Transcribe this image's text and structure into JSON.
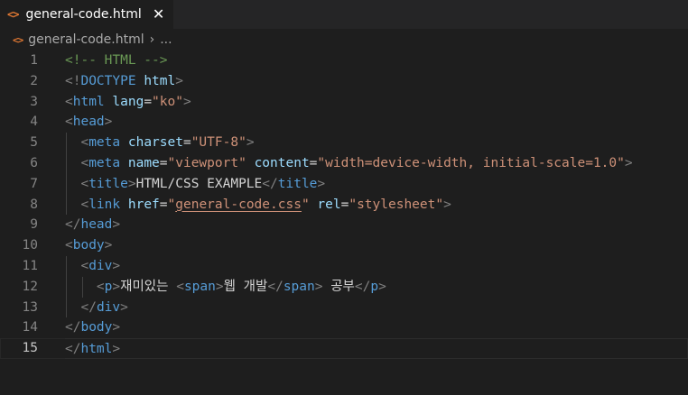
{
  "tab": {
    "icon": "<>",
    "filename": "general-code.html",
    "close": "✕"
  },
  "breadcrumb": {
    "icon": "<>",
    "file": "general-code.html",
    "separator": "›",
    "more": "..."
  },
  "editor": {
    "current_line": 15,
    "lines": [
      {
        "n": "1",
        "tokens": [
          [
            "t-comment",
            "<!-- HTML -->"
          ]
        ]
      },
      {
        "n": "2",
        "tokens": [
          [
            "t-punct",
            "<!"
          ],
          [
            "t-tag",
            "DOCTYPE"
          ],
          [
            "t-text",
            " "
          ],
          [
            "t-attr",
            "html"
          ],
          [
            "t-punct",
            ">"
          ]
        ]
      },
      {
        "n": "3",
        "tokens": [
          [
            "t-punct",
            "<"
          ],
          [
            "t-tag",
            "html"
          ],
          [
            "t-text",
            " "
          ],
          [
            "t-attr",
            "lang"
          ],
          [
            "t-text",
            "="
          ],
          [
            "t-str",
            "\"ko\""
          ],
          [
            "t-punct",
            ">"
          ]
        ]
      },
      {
        "n": "4",
        "tokens": [
          [
            "t-punct",
            "<"
          ],
          [
            "t-tag",
            "head"
          ],
          [
            "t-punct",
            ">"
          ]
        ]
      },
      {
        "n": "5",
        "tokens": [
          [
            "t-text",
            "  "
          ],
          [
            "t-punct",
            "<"
          ],
          [
            "t-tag",
            "meta"
          ],
          [
            "t-text",
            " "
          ],
          [
            "t-attr",
            "charset"
          ],
          [
            "t-text",
            "="
          ],
          [
            "t-str",
            "\"UTF-8\""
          ],
          [
            "t-punct",
            ">"
          ]
        ]
      },
      {
        "n": "6",
        "tokens": [
          [
            "t-text",
            "  "
          ],
          [
            "t-punct",
            "<"
          ],
          [
            "t-tag",
            "meta"
          ],
          [
            "t-text",
            " "
          ],
          [
            "t-attr",
            "name"
          ],
          [
            "t-text",
            "="
          ],
          [
            "t-str",
            "\"viewport\""
          ],
          [
            "t-text",
            " "
          ],
          [
            "t-attr",
            "content"
          ],
          [
            "t-text",
            "="
          ],
          [
            "t-str",
            "\"width=device-width, initial-scale=1.0\""
          ],
          [
            "t-punct",
            ">"
          ]
        ]
      },
      {
        "n": "7",
        "tokens": [
          [
            "t-text",
            "  "
          ],
          [
            "t-punct",
            "<"
          ],
          [
            "t-tag",
            "title"
          ],
          [
            "t-punct",
            ">"
          ],
          [
            "t-text",
            "HTML/CSS EXAMPLE"
          ],
          [
            "t-punct",
            "</"
          ],
          [
            "t-tag",
            "title"
          ],
          [
            "t-punct",
            ">"
          ]
        ]
      },
      {
        "n": "8",
        "tokens": [
          [
            "t-text",
            "  "
          ],
          [
            "t-punct",
            "<"
          ],
          [
            "t-tag",
            "link"
          ],
          [
            "t-text",
            " "
          ],
          [
            "t-attr",
            "href"
          ],
          [
            "t-text",
            "="
          ],
          [
            "t-str",
            "\""
          ],
          [
            "t-link",
            "general-code.css"
          ],
          [
            "t-str",
            "\""
          ],
          [
            "t-text",
            " "
          ],
          [
            "t-attr",
            "rel"
          ],
          [
            "t-text",
            "="
          ],
          [
            "t-str",
            "\"stylesheet\""
          ],
          [
            "t-punct",
            ">"
          ]
        ]
      },
      {
        "n": "9",
        "tokens": [
          [
            "t-punct",
            "</"
          ],
          [
            "t-tag",
            "head"
          ],
          [
            "t-punct",
            ">"
          ]
        ]
      },
      {
        "n": "10",
        "tokens": [
          [
            "t-punct",
            "<"
          ],
          [
            "t-tag",
            "body"
          ],
          [
            "t-punct",
            ">"
          ]
        ]
      },
      {
        "n": "11",
        "tokens": [
          [
            "t-text",
            "  "
          ],
          [
            "t-punct",
            "<"
          ],
          [
            "t-tag",
            "div"
          ],
          [
            "t-punct",
            ">"
          ]
        ]
      },
      {
        "n": "12",
        "tokens": [
          [
            "t-text",
            "    "
          ],
          [
            "t-punct",
            "<"
          ],
          [
            "t-tag",
            "p"
          ],
          [
            "t-punct",
            ">"
          ],
          [
            "t-text",
            "재미있는 "
          ],
          [
            "t-punct",
            "<"
          ],
          [
            "t-tag",
            "span"
          ],
          [
            "t-punct",
            ">"
          ],
          [
            "t-text",
            "웹 개발"
          ],
          [
            "t-punct",
            "</"
          ],
          [
            "t-tag",
            "span"
          ],
          [
            "t-punct",
            ">"
          ],
          [
            "t-text",
            " 공부"
          ],
          [
            "t-punct",
            "</"
          ],
          [
            "t-tag",
            "p"
          ],
          [
            "t-punct",
            ">"
          ]
        ]
      },
      {
        "n": "13",
        "tokens": [
          [
            "t-text",
            "  "
          ],
          [
            "t-punct",
            "</"
          ],
          [
            "t-tag",
            "div"
          ],
          [
            "t-punct",
            ">"
          ]
        ]
      },
      {
        "n": "14",
        "tokens": [
          [
            "t-punct",
            "</"
          ],
          [
            "t-tag",
            "body"
          ],
          [
            "t-punct",
            ">"
          ]
        ]
      },
      {
        "n": "15",
        "tokens": [
          [
            "t-punct",
            "</"
          ],
          [
            "t-tag",
            "html"
          ],
          [
            "t-punct",
            ">"
          ]
        ]
      }
    ]
  },
  "colors": {
    "background": "#1e1e1e",
    "tabbar": "#252526",
    "html_icon": "#e37933",
    "tag": "#569cd6",
    "attribute": "#9cdcfe",
    "string": "#ce9178",
    "comment": "#6a9955",
    "punctuation": "#808080"
  }
}
